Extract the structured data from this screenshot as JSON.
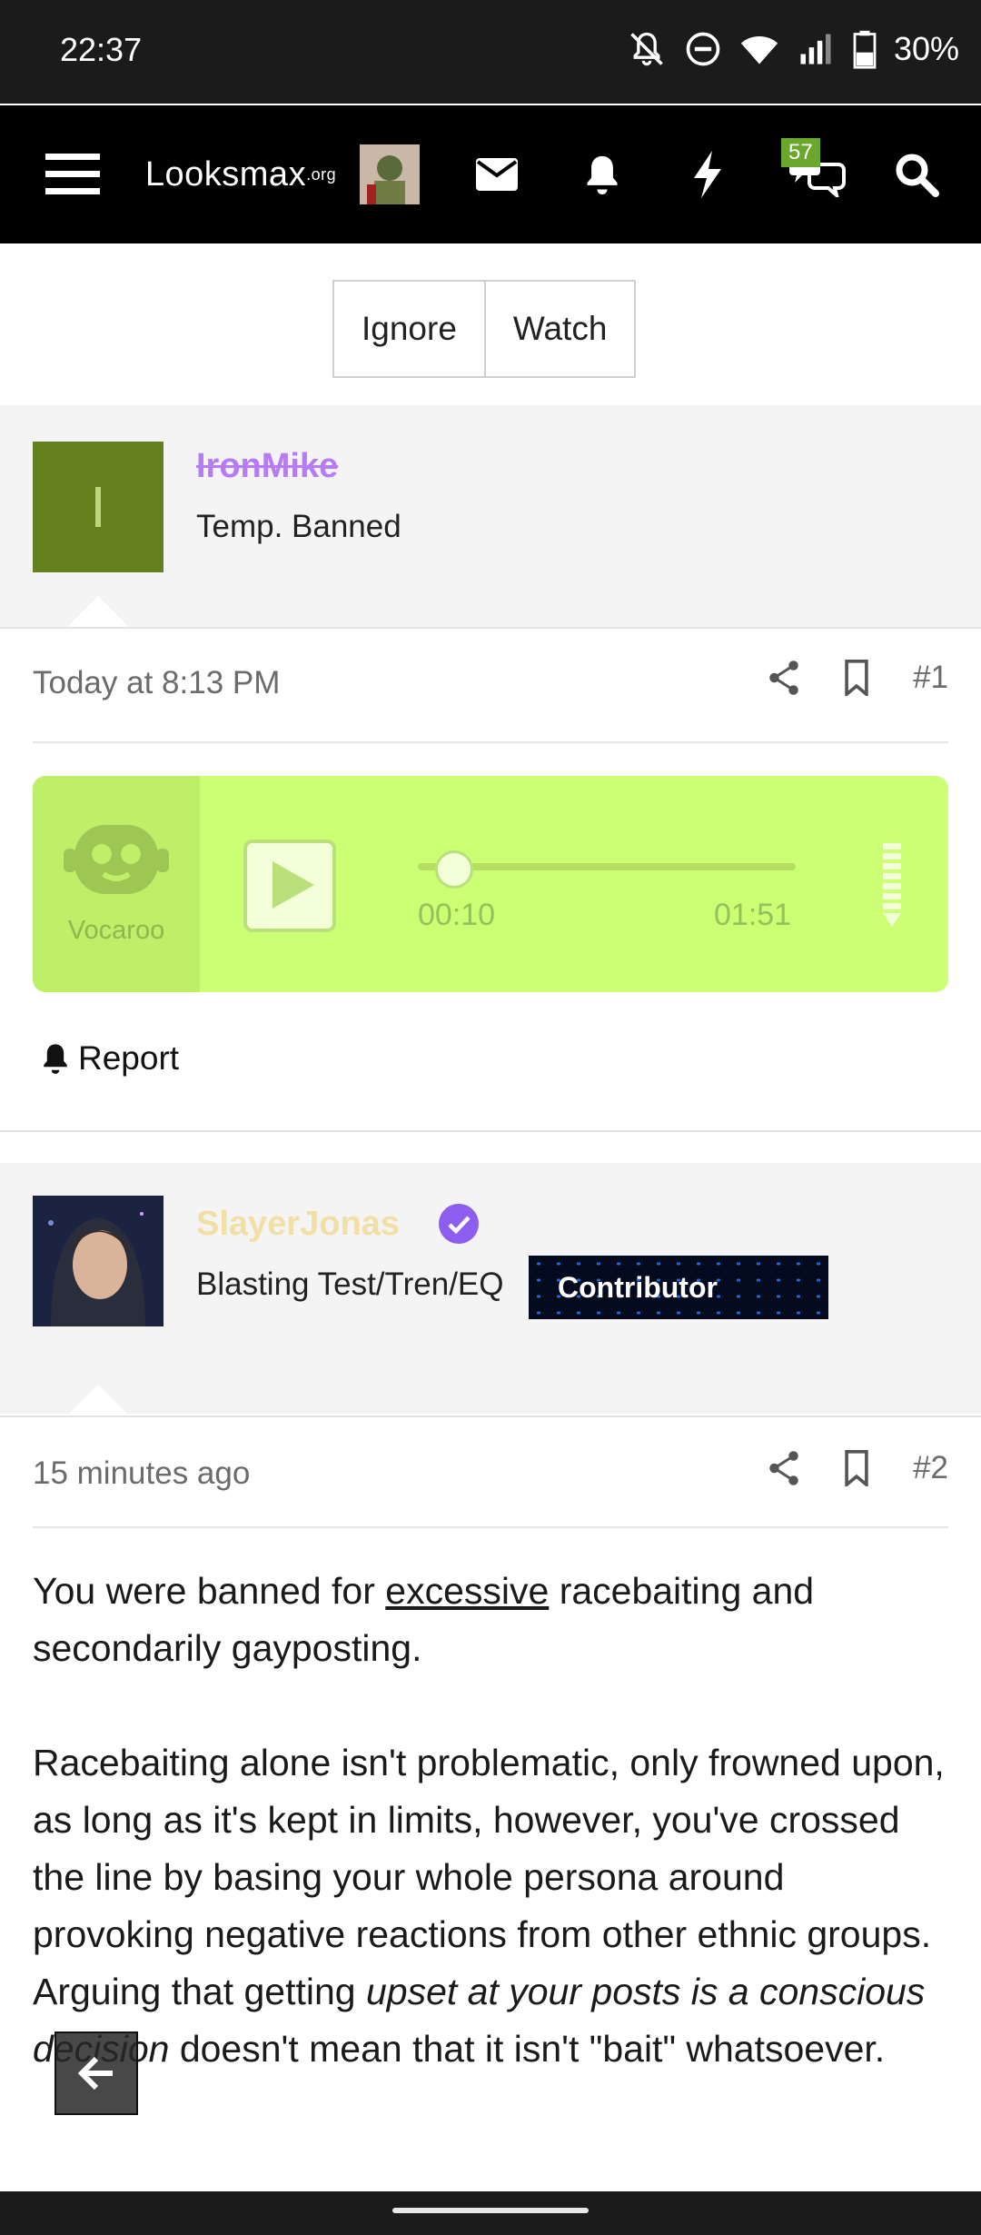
{
  "status_bar": {
    "time": "22:37",
    "battery": "30%"
  },
  "nav": {
    "logo_main": "Looksmax",
    "logo_suffix": ".org",
    "notification_count": "57"
  },
  "thread_actions": {
    "ignore_label": "Ignore",
    "watch_label": "Watch"
  },
  "post1": {
    "avatar_letter": "I",
    "avatar_color": "#637f1e",
    "username": "IronMike",
    "user_title": "Temp. Banned",
    "timestamp": "Today at 8:13 PM",
    "post_number": "#1",
    "audio": {
      "brand": "Vocaroo",
      "current_time": "00:10",
      "duration": "01:51",
      "progress": 0.09
    },
    "report_label": "Report"
  },
  "post2": {
    "username": "SlayerJonas",
    "user_title": "Blasting Test/Tren/EQ",
    "banner": "Contributor",
    "timestamp": "15 minutes ago",
    "post_number": "#2",
    "para1_a": "You were banned for ",
    "para1_link": "excessive",
    "para1_b": " racebaiting and secondarily gayposting.",
    "para2_a": "Racebaiting alone isn't problematic, only frowned upon, as long as it's kept in limits, however, you've crossed the line by basing your whole persona around provoking negative reactions from other ethnic groups. Arguing that getting ",
    "para2_em": "upset at your posts is a conscious decision",
    "para2_b": " doesn't mean that it isn't \"bait\" whatsoever."
  },
  "colors": {
    "accent_green": "#ccff73",
    "username1": "#b57cf5",
    "username2": "#f2dfa6"
  }
}
